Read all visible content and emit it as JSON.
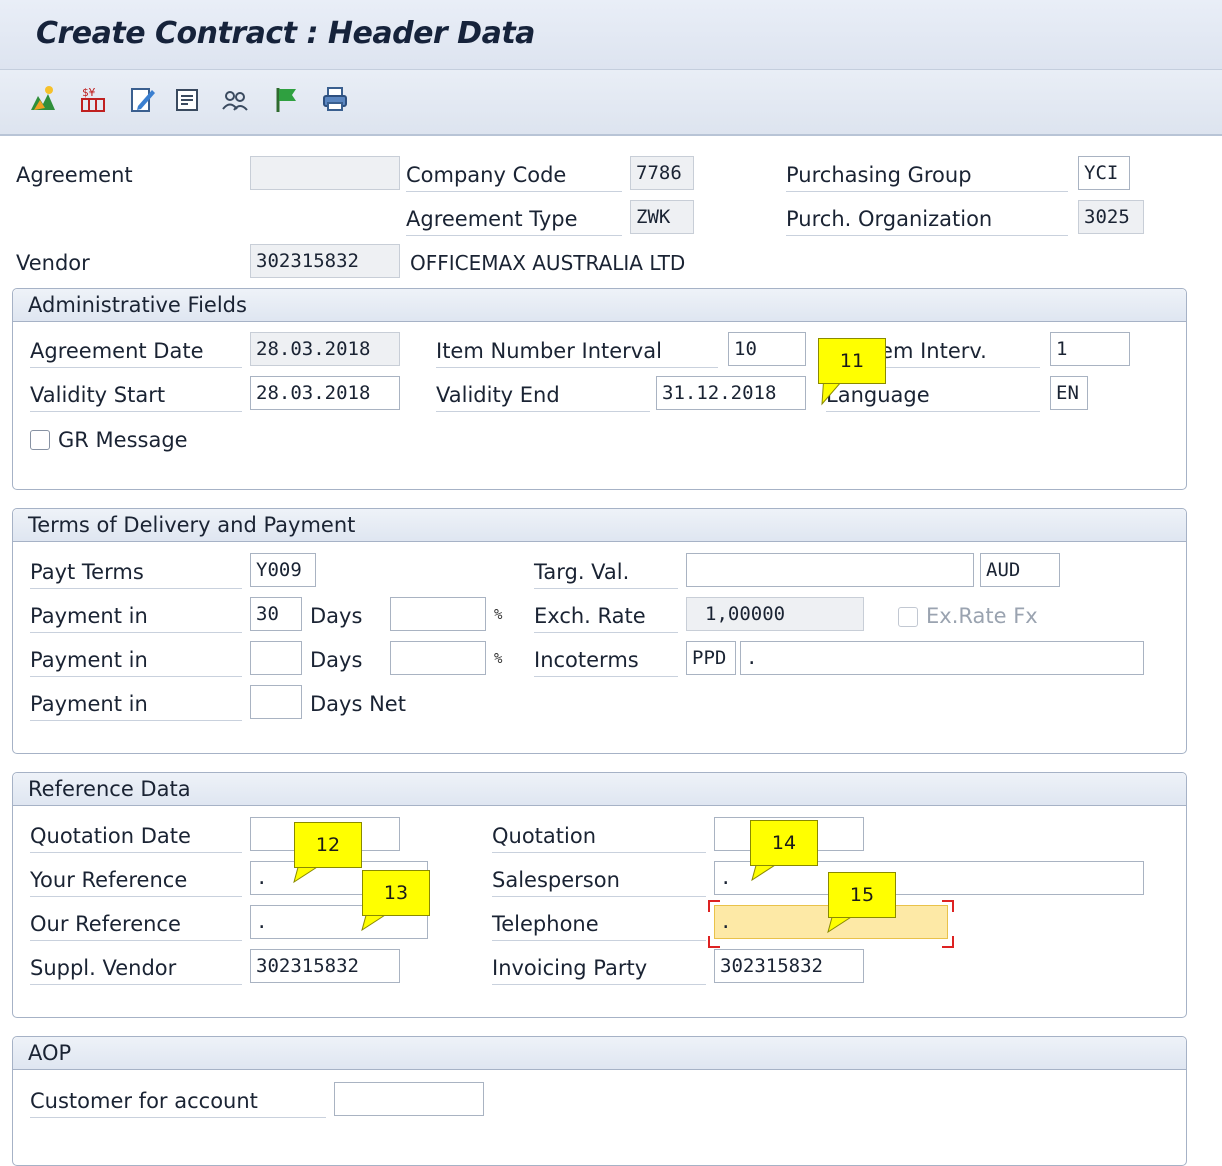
{
  "title": "Create Contract : Header Data",
  "toolbar": {
    "icons": [
      "header-overview-icon",
      "conditions-icon",
      "edit-texts-icon",
      "header-details-icon",
      "partners-icon",
      "flag-status-icon",
      "print-icon"
    ]
  },
  "header": {
    "agreement_label": "Agreement",
    "agreement_value": "",
    "company_code_label": "Company Code",
    "company_code_value": "7786",
    "purchasing_group_label": "Purchasing Group",
    "purchasing_group_value": "YCI",
    "agreement_type_label": "Agreement Type",
    "agreement_type_value": "ZWK",
    "purch_org_label": "Purch. Organization",
    "purch_org_value": "3025",
    "vendor_label": "Vendor",
    "vendor_value": "302315832",
    "vendor_name": "OFFICEMAX AUSTRALIA LTD"
  },
  "admin": {
    "title": "Administrative Fields",
    "agreement_date_label": "Agreement Date",
    "agreement_date_value": "28.03.2018",
    "item_number_interval_label": "Item Number Interval",
    "item_number_interval_value": "10",
    "subitem_interval_label": "Subitem Interv.",
    "subitem_interval_value": "1",
    "validity_start_label": "Validity Start",
    "validity_start_value": "28.03.2018",
    "validity_end_label": "Validity End",
    "validity_end_value": "31.12.2018",
    "language_label": "Language",
    "language_value": "EN",
    "gr_message_label": "GR Message",
    "gr_message_checked": false
  },
  "terms": {
    "title": "Terms of Delivery and Payment",
    "payt_terms_label": "Payt Terms",
    "payt_terms_value": "Y009",
    "targ_val_label": "Targ. Val.",
    "targ_val_value": "",
    "currency_value": "AUD",
    "payment_in_label": "Payment in",
    "payment_rows": [
      {
        "days": "30",
        "unit": "Days",
        "pct": "",
        "pct_sign": "%"
      },
      {
        "days": "",
        "unit": "Days",
        "pct": "",
        "pct_sign": "%"
      },
      {
        "days": "",
        "unit": "Days Net"
      }
    ],
    "exch_rate_label": "Exch. Rate",
    "exch_rate_value": "1,00000",
    "ex_rate_fx_label": "Ex.Rate Fx",
    "incoterms_label": "Incoterms",
    "incoterms_value": "PPD",
    "incoterms_desc": "."
  },
  "reference": {
    "title": "Reference Data",
    "quotation_date_label": "Quotation Date",
    "quotation_date_value": "",
    "quotation_label": "Quotation",
    "quotation_value": "",
    "your_reference_label": "Your Reference",
    "your_reference_value": ".",
    "salesperson_label": "Salesperson",
    "salesperson_value": ".",
    "our_reference_label": "Our Reference",
    "our_reference_value": ".",
    "telephone_label": "Telephone",
    "telephone_value": ".",
    "suppl_vendor_label": "Suppl. Vendor",
    "suppl_vendor_value": "302315832",
    "invoicing_party_label": "Invoicing Party",
    "invoicing_party_value": "302315832"
  },
  "aop": {
    "title": "AOP",
    "customer_for_account_label": "Customer for account",
    "customer_for_account_value": ""
  },
  "callouts": [
    "11",
    "12",
    "13",
    "14",
    "15"
  ],
  "colors": {
    "callout": "#ffff00",
    "focus_field": "#fde9a6",
    "group_border": "#a6b2c6",
    "title_bg": "#dde4f0"
  }
}
